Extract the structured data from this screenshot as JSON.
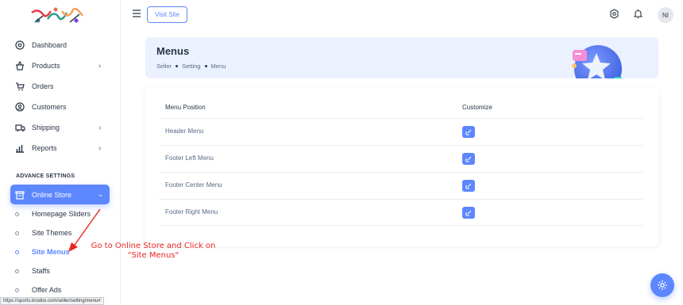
{
  "sidebar": {
    "logo_alt": "store-logo",
    "items": [
      {
        "label": "Dashboard",
        "icon": "dashboard-icon"
      },
      {
        "label": "Products",
        "icon": "products-icon",
        "has_children": true
      },
      {
        "label": "Orders",
        "icon": "cart-icon"
      },
      {
        "label": "Customers",
        "icon": "user-circle-icon"
      },
      {
        "label": "Shipping",
        "icon": "truck-icon",
        "has_children": true
      },
      {
        "label": "Reports",
        "icon": "chart-icon",
        "has_children": true
      }
    ],
    "section_title": "ADVANCE SETTINGS",
    "active_group": {
      "label": "Online Store",
      "icon": "store-icon"
    },
    "sub_items": [
      {
        "label": "Homepage Sliders"
      },
      {
        "label": "Site Themes"
      },
      {
        "label": "Site Menus",
        "active": true
      },
      {
        "label": "Staffs"
      },
      {
        "label": "Offer Ads"
      }
    ]
  },
  "header": {
    "visit_site_label": "Visit Site",
    "avatar_initials": "NI"
  },
  "breadcrumb": {
    "title": "Menus",
    "path": [
      "Seller",
      "Setting",
      "Menu"
    ]
  },
  "table": {
    "columns": [
      "Menu Position",
      "Customize"
    ],
    "rows": [
      {
        "position": "Header Menu"
      },
      {
        "position": "Footer Left Menu"
      },
      {
        "position": "Footer Center Menu"
      },
      {
        "position": "Footer Right Menu"
      }
    ]
  },
  "annotation": {
    "line1": "Go to Online Store and Click on",
    "line2": "\"Site Menus\""
  },
  "status_url": "https://sports.brodox.com/seller/setting/menu#",
  "colors": {
    "accent": "#5d87ff",
    "annotation": "#e8261f",
    "crumb_bg": "#ebf1ff"
  }
}
